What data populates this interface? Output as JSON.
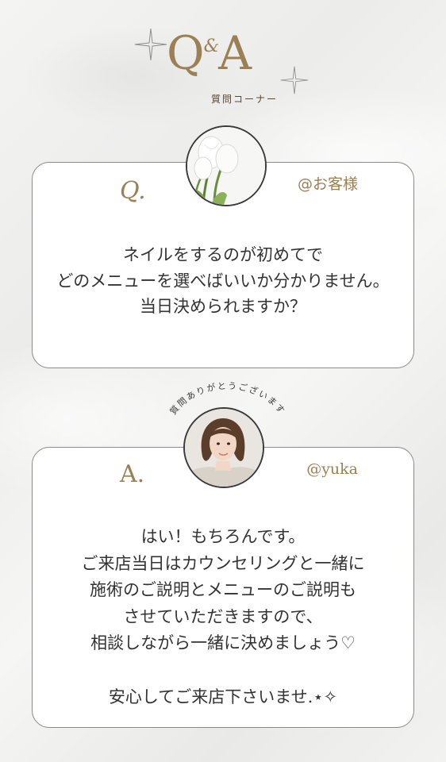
{
  "header": {
    "title_q": "Q",
    "title_amp": "&",
    "title_a": "A",
    "subtitle": "質問コーナー"
  },
  "question": {
    "letter": "Q.",
    "user": "@お客様",
    "text": "ネイルをするのが初めてで\nどのメニューを選べばいいか分かりません。\n当日決められますか？",
    "avatar_icon": "tulip-photo"
  },
  "answer": {
    "letter": "A.",
    "user": "@yuka",
    "thanks": "質問ありがとうございます",
    "text": "はい！もちろんです。\nご来店当日はカウンセリングと一緒に\n施術のご説明とメニューのご説明も\nさせていただきますので、\n相談しながら一緒に決めましょう♡\n\n安心してご来店下さいませ.⋆✧",
    "avatar_icon": "staff-portrait-photo"
  },
  "colors": {
    "gold": "#9b7f55",
    "border": "#8a8a8a"
  }
}
